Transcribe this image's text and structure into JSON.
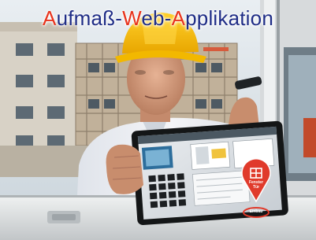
{
  "title": {
    "parts": [
      {
        "text": "A",
        "color": "#e8331c"
      },
      {
        "text": "ufmaß-",
        "color": "#1f2d86"
      },
      {
        "text": "W",
        "color": "#e8331c"
      },
      {
        "text": "eb-",
        "color": "#1f2d86"
      },
      {
        "text": "A",
        "color": "#e8331c"
      },
      {
        "text": "pplikation",
        "color": "#1f2d86"
      }
    ]
  },
  "pin": {
    "line1": "Fenster",
    "line2": "Tür",
    "bubble": "Einbau",
    "icon": "window-frame-icon",
    "color": "#e03a2b"
  }
}
